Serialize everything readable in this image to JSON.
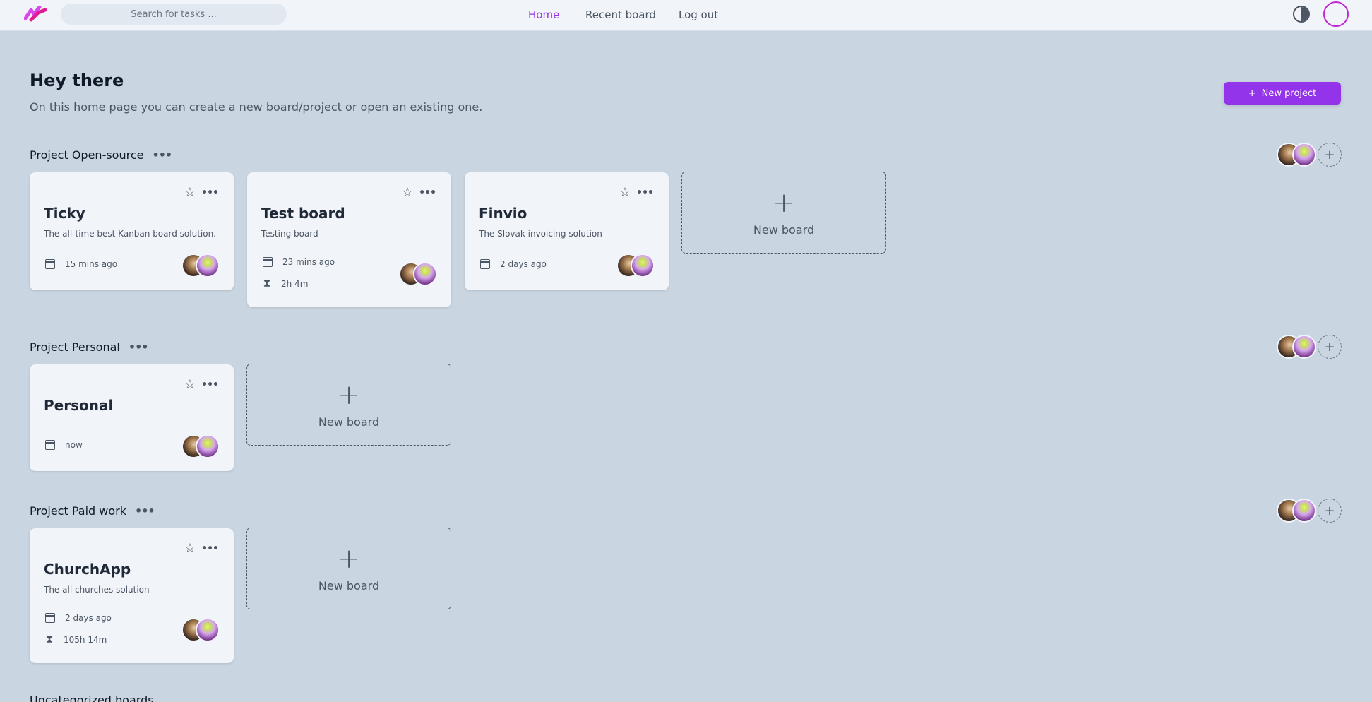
{
  "nav": {
    "search_placeholder": "Search for tasks ...",
    "home": "Home",
    "recent": "Recent board",
    "logout": "Log out"
  },
  "header": {
    "title": "Hey there",
    "subtitle": "On this home page you can create a new board/project or open an existing one.",
    "new_project": "New project",
    "new_project_icon": "+"
  },
  "colors": {
    "accent": "#9333ea",
    "background": "#c9d5e1",
    "card": "#f1f4f9"
  },
  "projects": [
    {
      "title": "Project Open-source",
      "more": "•••",
      "add": "+",
      "boards": [
        {
          "name": "Ticky",
          "description": "The all-time best Kanban board solution.",
          "updated": "15 mins ago"
        },
        {
          "name": "Test board",
          "description": "Testing board",
          "updated": "23 mins ago",
          "time": "2h 4m"
        },
        {
          "name": "Finvio",
          "description": "The Slovak invoicing solution",
          "updated": "2 days ago"
        }
      ]
    },
    {
      "title": "Project Personal",
      "more": "•••",
      "add": "+",
      "boards": [
        {
          "name": "Personal",
          "updated": "now"
        }
      ]
    },
    {
      "title": "Project Paid work",
      "more": "•••",
      "add": "+",
      "boards": [
        {
          "name": "ChurchApp",
          "description": "The all churches solution",
          "updated": "2 days ago",
          "time": "105h 14m"
        }
      ]
    }
  ],
  "new_board": {
    "plus": "+",
    "label": "New board"
  },
  "icons": {
    "star": "☆",
    "more": "•••",
    "hourglass": "⧗"
  },
  "uncategorized": "Uncategorized boards"
}
